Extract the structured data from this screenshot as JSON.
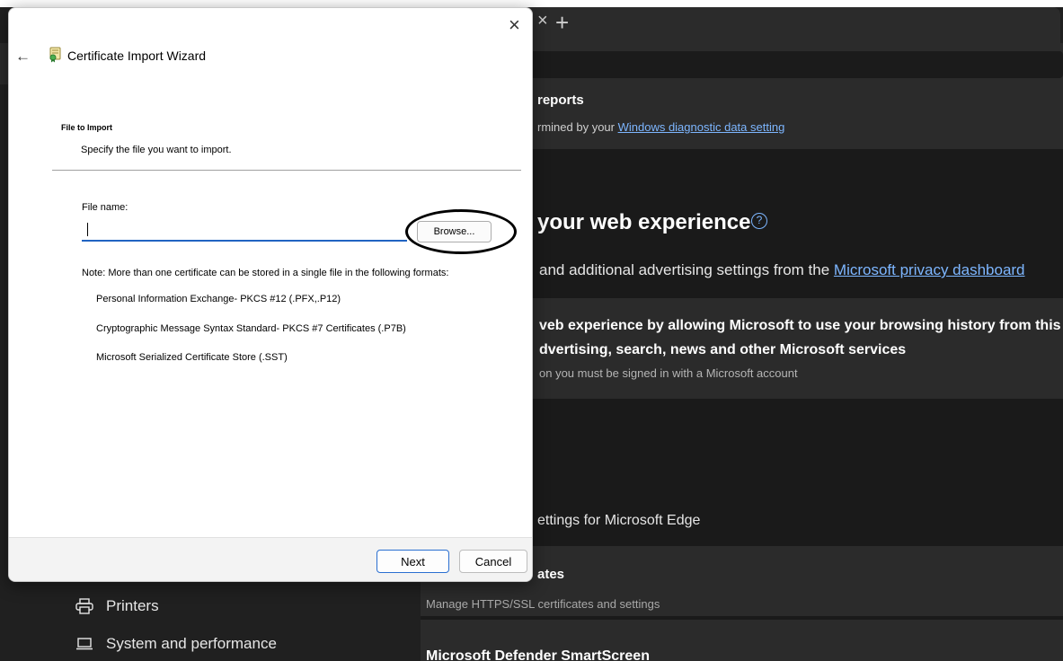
{
  "browser": {
    "tab_close_glyph": "×",
    "new_tab_glyph": "+"
  },
  "settings": {
    "reports": {
      "title": "reports",
      "subtitle_prefix": "rmined by your ",
      "subtitle_link": "Windows diagnostic data setting"
    },
    "web_experience": {
      "heading": "your web experience",
      "ads_prefix": " and additional advertising settings from the ",
      "ads_link": "Microsoft privacy dashboard",
      "personalize_line1": "veb experience by allowing Microsoft to use your browsing history from this a",
      "personalize_line2": "dvertising, search, news and other Microsoft services",
      "personalize_note": " on you must be signed in with a Microsoft account"
    },
    "edge_settings_label": "ettings for Microsoft Edge",
    "certificates": {
      "title": "ates",
      "subtitle": "Manage HTTPS/SSL certificates and settings"
    },
    "smartscreen_title": "Microsoft Defender SmartScreen",
    "sidebar": {
      "items": [
        {
          "label": "Printers",
          "icon": "printer-icon"
        },
        {
          "label": "System and performance",
          "icon": "laptop-icon"
        }
      ]
    }
  },
  "wizard": {
    "title": "Certificate Import Wizard",
    "close_glyph": "×",
    "back_glyph": "←",
    "section_title": "File to Import",
    "section_subtitle": "Specify the file you want to import.",
    "file_name_label": "File name:",
    "file_name_value": "",
    "browse_label": "Browse...",
    "note": "Note:  More than one certificate can be stored in a single file in the following formats:",
    "formats": [
      "Personal Information Exchange- PKCS #12 (.PFX,.P12)",
      "Cryptographic Message Syntax Standard- PKCS #7 Certificates (.P7B)",
      "Microsoft Serialized Certificate Store (.SST)"
    ],
    "next_label": "Next",
    "cancel_label": "Cancel"
  },
  "colors": {
    "accent": "#2164c2",
    "link": "#7db6ff",
    "dark_bg": "#202020"
  }
}
